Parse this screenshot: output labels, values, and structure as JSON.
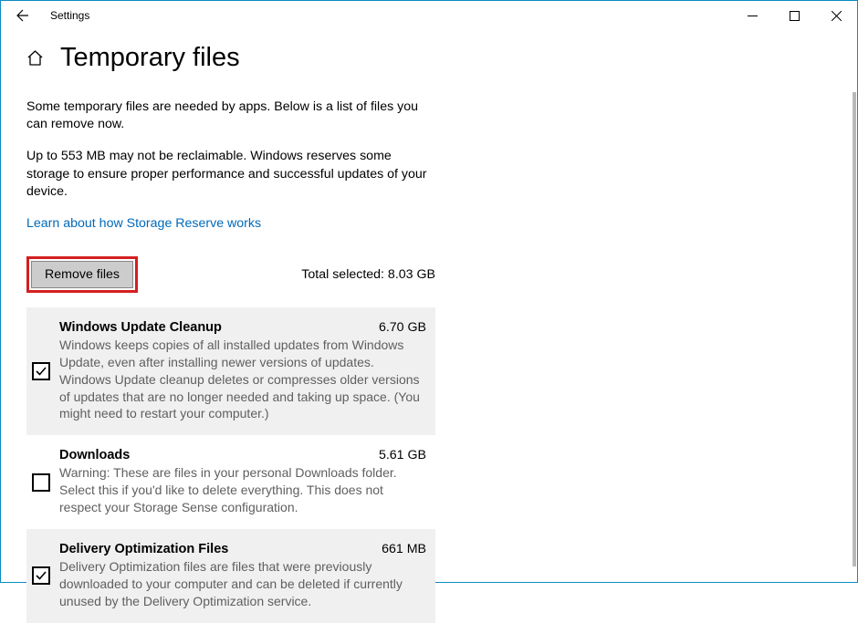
{
  "app_title": "Settings",
  "page_title": "Temporary files",
  "info1": "Some temporary files are needed by apps. Below is a list of files you can remove now.",
  "info2": "Up to 553 MB may not be reclaimable. Windows reserves some storage to ensure proper performance and successful updates of your device.",
  "learn_link": "Learn about how Storage Reserve works",
  "remove_btn": "Remove files",
  "total_selected": "Total selected: 8.03 GB",
  "items": [
    {
      "title": "Windows Update Cleanup",
      "size": "6.70 GB",
      "desc": "Windows keeps copies of all installed updates from Windows Update, even after installing newer versions of updates. Windows Update cleanup deletes or compresses older versions of updates that are no longer needed and taking up space. (You might need to restart your computer.)",
      "checked": true
    },
    {
      "title": "Downloads",
      "size": "5.61 GB",
      "desc": "Warning: These are files in your personal Downloads folder. Select this if you'd like to delete everything. This does not respect your Storage Sense configuration.",
      "checked": false
    },
    {
      "title": "Delivery Optimization Files",
      "size": "661 MB",
      "desc": "Delivery Optimization files are files that were previously downloaded to your computer and can be deleted if currently unused by the Delivery Optimization service.",
      "checked": true
    }
  ]
}
